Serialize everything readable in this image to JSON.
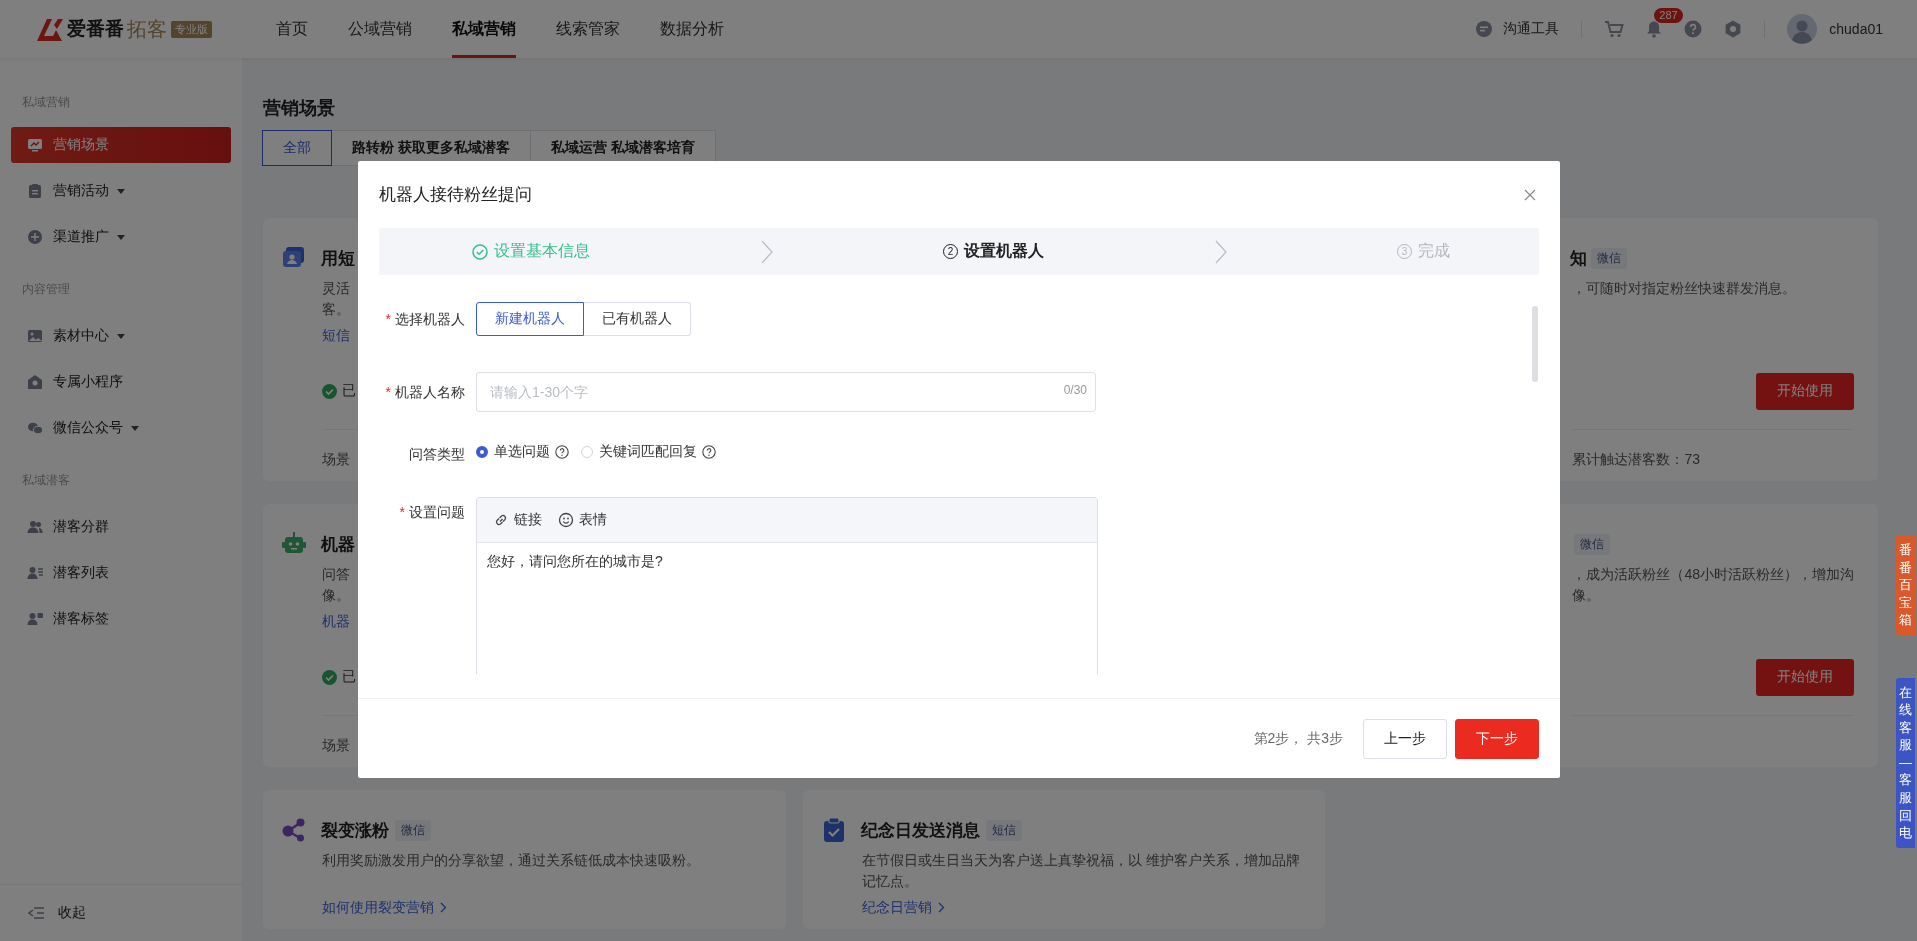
{
  "header": {
    "logo": {
      "brand": "爱番番",
      "product": "拓客",
      "edition": "专业版"
    },
    "nav": [
      {
        "label": "首页",
        "selected": false
      },
      {
        "label": "公域营销",
        "selected": false
      },
      {
        "label": "私域营销",
        "selected": true
      },
      {
        "label": "线索管家",
        "selected": false
      },
      {
        "label": "数据分析",
        "selected": false
      }
    ],
    "tools": {
      "chat_label": "沟通工具",
      "notification_count": "287",
      "username": "chuda01"
    }
  },
  "sidebar": {
    "sections": [
      {
        "title": "私域营销",
        "items": [
          {
            "label": "营销场景",
            "selected": true,
            "expandable": false
          },
          {
            "label": "营销活动",
            "selected": false,
            "expandable": true
          },
          {
            "label": "渠道推广",
            "selected": false,
            "expandable": true
          }
        ]
      },
      {
        "title": "内容管理",
        "items": [
          {
            "label": "素材中心",
            "selected": false,
            "expandable": true
          },
          {
            "label": "专属小程序",
            "selected": false,
            "expandable": false
          },
          {
            "label": "微信公众号",
            "selected": false,
            "expandable": true
          }
        ]
      },
      {
        "title": "私域潜客",
        "items": [
          {
            "label": "潜客分群",
            "selected": false,
            "expandable": false
          },
          {
            "label": "潜客列表",
            "selected": false,
            "expandable": false
          },
          {
            "label": "潜客标签",
            "selected": false,
            "expandable": false
          }
        ]
      }
    ],
    "collapse_label": "收起"
  },
  "main": {
    "title": "营销场景",
    "tabs": [
      {
        "label": "全部",
        "selected": true
      },
      {
        "label": "路转粉 获取更多私域潜客",
        "selected": false
      },
      {
        "label": "私域运营 私域潜客培育",
        "selected": false
      }
    ],
    "scene_cards": [
      {
        "kind": "left_peek",
        "title": "用短",
        "desc_lines": [
          "灵活",
          "客。"
        ],
        "link": "短信",
        "status": "已",
        "footer": "场景"
      },
      {
        "kind": "right_peek",
        "title": "知",
        "tag": "微信",
        "desc_lines": [
          "，可随时对指定粉丝快速群发消息。"
        ],
        "button": "开始使用",
        "footer": "累计触达潜客数：73"
      },
      {
        "kind": "left_peek",
        "title": "机器",
        "desc_lines": [
          "问答",
          "像。"
        ],
        "link": "机器",
        "status": "已",
        "footer": "场景"
      },
      {
        "kind": "right_peek",
        "tag": "微信",
        "desc_lines": [
          "，成为活跃粉丝（48小时活跃粉丝），增加沟",
          "像。"
        ],
        "button": "开始使用"
      },
      {
        "kind": "full",
        "title": "裂变涨粉",
        "tag": "微信",
        "desc": "利用奖励激发用户的分享欲望，通过关系链低成本快速吸粉。",
        "link": "如何使用裂变营销"
      },
      {
        "kind": "full",
        "title": "纪念日发送消息",
        "tag": "短信",
        "desc": "在节假日或生日当天为客户送上真挚祝福，以 维护客户关系，增加品牌记忆点。",
        "link": "纪念日营销"
      }
    ]
  },
  "floating_tabs": [
    {
      "label": "番番百宝箱",
      "color": "#d9592b"
    },
    {
      "label": "在线客服—客服回电",
      "color": "#3c55c4"
    }
  ],
  "modal": {
    "title": "机器人接待粉丝提问",
    "steps": [
      {
        "label": "设置基本信息",
        "completed": true,
        "active": false
      },
      {
        "label": "设置机器人",
        "number": "2",
        "completed": false,
        "active": true
      },
      {
        "label": "完成",
        "number": "3",
        "completed": false,
        "active": false
      }
    ],
    "fields": [
      {
        "kind": "segmented",
        "required_mark": "*",
        "label": "选择机器人",
        "options": [
          {
            "label": "新建机器人",
            "selected": true
          },
          {
            "label": "已有机器人",
            "selected": false
          }
        ]
      },
      {
        "kind": "text",
        "required_mark": "*",
        "label": "机器人名称",
        "placeholder": "请输入1-30个字",
        "counter": "0/30"
      },
      {
        "kind": "radio",
        "label": "问答类型",
        "options": [
          {
            "label": "单选问题",
            "selected": true
          },
          {
            "label": "关键词匹配回复",
            "selected": false
          }
        ]
      },
      {
        "kind": "editor",
        "required_mark": "*",
        "label": "设置问题",
        "toolbar": [
          "链接",
          "表情"
        ],
        "value": "您好，请问您所在的城市是?"
      }
    ],
    "footer": {
      "progress": "第2步， 共3步",
      "buttons": [
        {
          "label": "上一步",
          "kind": "secondary"
        },
        {
          "label": "下一步",
          "kind": "primary"
        }
      ]
    }
  }
}
